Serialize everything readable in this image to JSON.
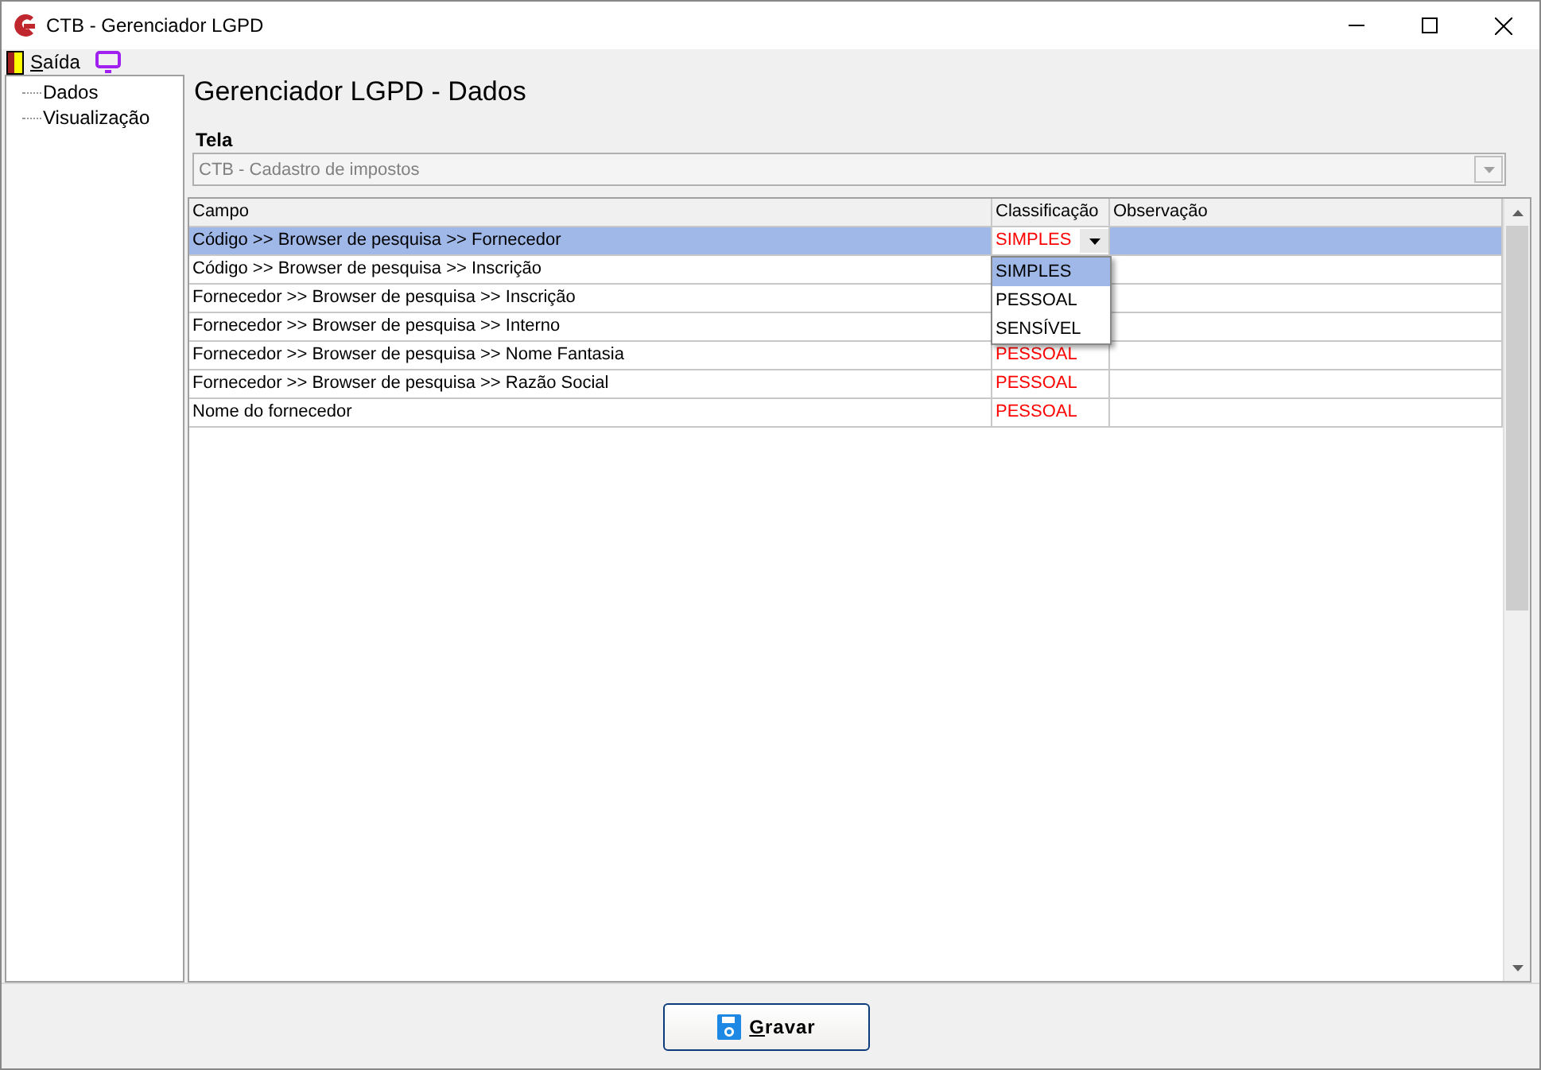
{
  "window": {
    "title": "CTB - Gerenciador LGPD"
  },
  "menu": [
    {
      "label": "Saída",
      "kind": "exit"
    },
    {
      "kind": "screen"
    }
  ],
  "tree": [
    {
      "label": "Dados"
    },
    {
      "label": "Visualização"
    }
  ],
  "heading": "Gerenciador LGPD - Dados",
  "tela": {
    "label": "Tela",
    "value": "CTB - Cadastro de impostos",
    "disabled": true
  },
  "table": {
    "columns": [
      "Campo",
      "Classificação",
      "Observação"
    ],
    "rows": [
      {
        "campo": "Código >> Browser de pesquisa >> Fornecedor",
        "classification": "SIMPLES",
        "editing": true,
        "selected": true
      },
      {
        "campo": "Código >> Browser de pesquisa >> Inscrição",
        "selected": false
      },
      {
        "campo": "Fornecedor >> Browser de pesquisa >> Inscrição",
        "selected": false
      },
      {
        "campo": "Fornecedor >> Browser de pesquisa >> Interno",
        "selected": false
      },
      {
        "campo": "Fornecedor >> Browser de pesquisa >> Nome Fantasia",
        "classification": "PESSOAL",
        "selected": false
      },
      {
        "campo": "Fornecedor >> Browser de pesquisa >> Razão Social",
        "classification": "PESSOAL",
        "selected": false
      },
      {
        "campo": "Nome do fornecedor",
        "classification": "PESSOAL",
        "selected": false
      }
    ],
    "dropdown": [
      {
        "label": "SIMPLES",
        "selected": true
      },
      {
        "label": "PESSOAL",
        "selected": false
      },
      {
        "label": "SENSÍVEL",
        "selected": false
      }
    ]
  },
  "button": {
    "label": "Gravar"
  }
}
